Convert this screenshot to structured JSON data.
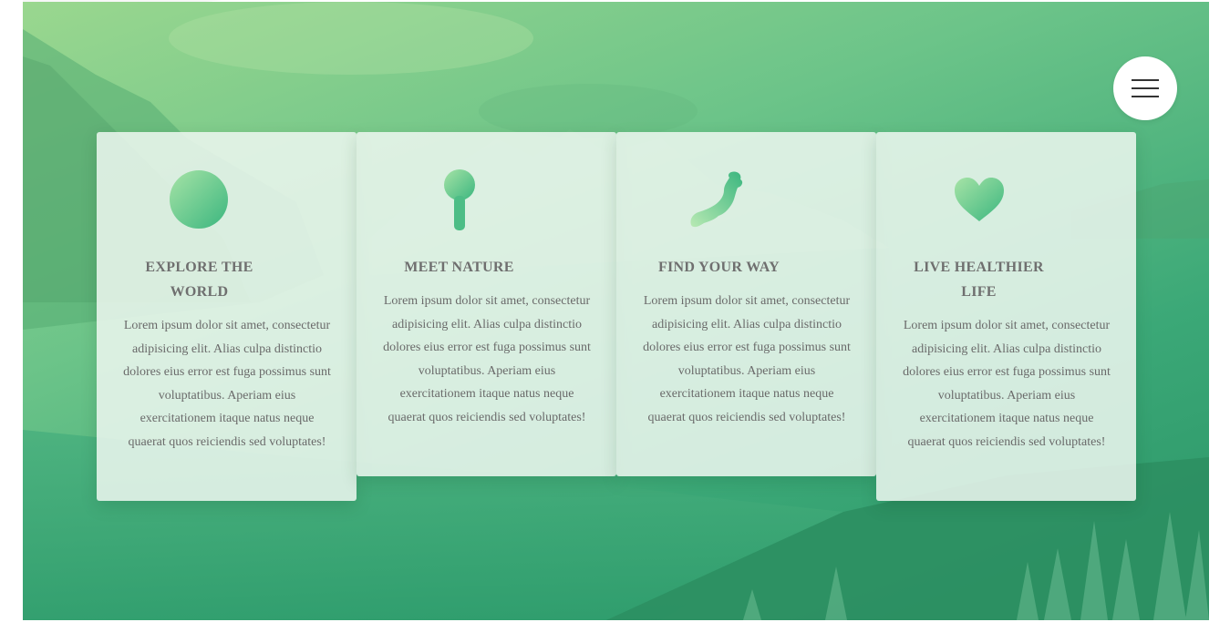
{
  "menu": {
    "icon": "hamburger-icon"
  },
  "colors": {
    "accent_light": "#a6e3a6",
    "accent_dark": "#3bb67f",
    "card_background": "rgba(238,247,240,0.86)",
    "text": "#6a6a6a"
  },
  "cards": [
    {
      "icon": "circle-icon",
      "title_line1": "EXPLORE THE",
      "title_line2": "WORLD",
      "body": "Lorem ipsum dolor sit amet, consectetur adipisicing elit. Alias culpa distinctio dolores eius error est fuga possimus sunt voluptatibus. Aperiam eius exercitationem itaque natus neque quaerat quos reiciendis sed voluptates!"
    },
    {
      "icon": "pin-icon",
      "title_line1": "MEET NATURE",
      "title_line2": "",
      "body": "Lorem ipsum dolor sit amet, consectetur adipisicing elit. Alias culpa distinctio dolores eius error est fuga possimus sunt voluptatibus. Aperiam eius exercitationem itaque natus neque quaerat quos reiciendis sed voluptates!"
    },
    {
      "icon": "japan-map-icon",
      "title_line1": "FIND YOUR WAY",
      "title_line2": "",
      "body": "Lorem ipsum dolor sit amet, consectetur adipisicing elit. Alias culpa distinctio dolores eius error est fuga possimus sunt voluptatibus. Aperiam eius exercitationem itaque natus neque quaerat quos reiciendis sed voluptates!"
    },
    {
      "icon": "heart-icon",
      "title_line1": "LIVE HEALTHIER",
      "title_line2": "LIFE",
      "body": "Lorem ipsum dolor sit amet, consectetur adipisicing elit. Alias culpa distinctio dolores eius error est fuga possimus sunt voluptatibus. Aperiam eius exercitationem itaque natus neque quaerat quos reiciendis sed voluptates!"
    }
  ]
}
